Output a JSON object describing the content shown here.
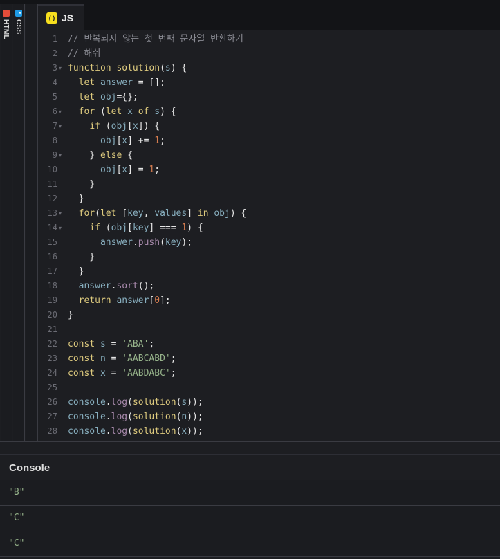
{
  "sidebar": {
    "html_tab": {
      "label": "HTML",
      "icon": "html-icon"
    },
    "css_tab": {
      "label": "CSS",
      "icon": "css-icon"
    }
  },
  "editor_tab": {
    "label": "JS",
    "icon": "js-icon"
  },
  "code_lines": [
    {
      "n": "1",
      "fold": false,
      "tokens": [
        [
          "cm",
          "// 반복되지 않는 첫 번째 문자열 반환하기"
        ]
      ]
    },
    {
      "n": "2",
      "fold": false,
      "tokens": [
        [
          "cm",
          "// 해쉬"
        ]
      ]
    },
    {
      "n": "3",
      "fold": true,
      "tokens": [
        [
          "kw",
          "function "
        ],
        [
          "fn",
          "solution"
        ],
        [
          "pn",
          "("
        ],
        [
          "id",
          "s"
        ],
        [
          "pn",
          ") {"
        ]
      ]
    },
    {
      "n": "4",
      "fold": false,
      "tokens": [
        [
          "pn",
          "  "
        ],
        [
          "kw",
          "let "
        ],
        [
          "id",
          "answer"
        ],
        [
          "pn",
          " = [];"
        ]
      ]
    },
    {
      "n": "5",
      "fold": false,
      "tokens": [
        [
          "pn",
          "  "
        ],
        [
          "kw",
          "let "
        ],
        [
          "id",
          "obj"
        ],
        [
          "pn",
          "={};"
        ]
      ]
    },
    {
      "n": "6",
      "fold": true,
      "tokens": [
        [
          "pn",
          "  "
        ],
        [
          "kw",
          "for "
        ],
        [
          "pn",
          "("
        ],
        [
          "kw",
          "let "
        ],
        [
          "id",
          "x"
        ],
        [
          "kw",
          " of "
        ],
        [
          "id",
          "s"
        ],
        [
          "pn",
          ") {"
        ]
      ]
    },
    {
      "n": "7",
      "fold": true,
      "tokens": [
        [
          "pn",
          "    "
        ],
        [
          "kw",
          "if "
        ],
        [
          "pn",
          "("
        ],
        [
          "id",
          "obj"
        ],
        [
          "pn",
          "["
        ],
        [
          "id",
          "x"
        ],
        [
          "pn",
          "]) {"
        ]
      ]
    },
    {
      "n": "8",
      "fold": false,
      "tokens": [
        [
          "pn",
          "      "
        ],
        [
          "id",
          "obj"
        ],
        [
          "pn",
          "["
        ],
        [
          "id",
          "x"
        ],
        [
          "pn",
          "] += "
        ],
        [
          "num",
          "1"
        ],
        [
          "pn",
          ";"
        ]
      ]
    },
    {
      "n": "9",
      "fold": true,
      "tokens": [
        [
          "pn",
          "    } "
        ],
        [
          "kw",
          "else "
        ],
        [
          "pn",
          "{"
        ]
      ]
    },
    {
      "n": "10",
      "fold": false,
      "tokens": [
        [
          "pn",
          "      "
        ],
        [
          "id",
          "obj"
        ],
        [
          "pn",
          "["
        ],
        [
          "id",
          "x"
        ],
        [
          "pn",
          "] = "
        ],
        [
          "num",
          "1"
        ],
        [
          "pn",
          ";"
        ]
      ]
    },
    {
      "n": "11",
      "fold": false,
      "tokens": [
        [
          "pn",
          "    }"
        ]
      ]
    },
    {
      "n": "12",
      "fold": false,
      "tokens": [
        [
          "pn",
          "  }"
        ]
      ]
    },
    {
      "n": "13",
      "fold": true,
      "tokens": [
        [
          "pn",
          "  "
        ],
        [
          "kw",
          "for"
        ],
        [
          "pn",
          "("
        ],
        [
          "kw",
          "let "
        ],
        [
          "pn",
          "["
        ],
        [
          "id",
          "key"
        ],
        [
          "pn",
          ", "
        ],
        [
          "id",
          "values"
        ],
        [
          "pn",
          "] "
        ],
        [
          "kw",
          "in "
        ],
        [
          "id",
          "obj"
        ],
        [
          "pn",
          ") {"
        ]
      ]
    },
    {
      "n": "14",
      "fold": true,
      "tokens": [
        [
          "pn",
          "    "
        ],
        [
          "kw",
          "if "
        ],
        [
          "pn",
          "("
        ],
        [
          "id",
          "obj"
        ],
        [
          "pn",
          "["
        ],
        [
          "id",
          "key"
        ],
        [
          "pn",
          "] === "
        ],
        [
          "num",
          "1"
        ],
        [
          "pn",
          ") {"
        ]
      ]
    },
    {
      "n": "15",
      "fold": false,
      "tokens": [
        [
          "pn",
          "      "
        ],
        [
          "id",
          "answer"
        ],
        [
          "pn",
          "."
        ],
        [
          "pr",
          "push"
        ],
        [
          "pn",
          "("
        ],
        [
          "id",
          "key"
        ],
        [
          "pn",
          ");"
        ]
      ]
    },
    {
      "n": "16",
      "fold": false,
      "tokens": [
        [
          "pn",
          "    }"
        ]
      ]
    },
    {
      "n": "17",
      "fold": false,
      "tokens": [
        [
          "pn",
          "  }"
        ]
      ]
    },
    {
      "n": "18",
      "fold": false,
      "tokens": [
        [
          "pn",
          "  "
        ],
        [
          "id",
          "answer"
        ],
        [
          "pn",
          "."
        ],
        [
          "pr",
          "sort"
        ],
        [
          "pn",
          "();"
        ]
      ]
    },
    {
      "n": "19",
      "fold": false,
      "tokens": [
        [
          "pn",
          "  "
        ],
        [
          "kw",
          "return "
        ],
        [
          "id",
          "answer"
        ],
        [
          "pn",
          "["
        ],
        [
          "num",
          "0"
        ],
        [
          "pn",
          "];"
        ]
      ]
    },
    {
      "n": "20",
      "fold": false,
      "tokens": [
        [
          "pn",
          "}"
        ]
      ]
    },
    {
      "n": "21",
      "fold": false,
      "tokens": []
    },
    {
      "n": "22",
      "fold": false,
      "tokens": [
        [
          "kw",
          "const "
        ],
        [
          "id",
          "s"
        ],
        [
          "pn",
          " = "
        ],
        [
          "str",
          "'ABA'"
        ],
        [
          "pn",
          ";"
        ]
      ]
    },
    {
      "n": "23",
      "fold": false,
      "tokens": [
        [
          "kw",
          "const "
        ],
        [
          "id",
          "n"
        ],
        [
          "pn",
          " = "
        ],
        [
          "str",
          "'AABCABD'"
        ],
        [
          "pn",
          ";"
        ]
      ]
    },
    {
      "n": "24",
      "fold": false,
      "tokens": [
        [
          "kw",
          "const "
        ],
        [
          "id",
          "x"
        ],
        [
          "pn",
          " = "
        ],
        [
          "str",
          "'AABDABC'"
        ],
        [
          "pn",
          ";"
        ]
      ]
    },
    {
      "n": "25",
      "fold": false,
      "tokens": []
    },
    {
      "n": "26",
      "fold": false,
      "tokens": [
        [
          "id",
          "console"
        ],
        [
          "pn",
          "."
        ],
        [
          "pr",
          "log"
        ],
        [
          "pn",
          "("
        ],
        [
          "fn",
          "solution"
        ],
        [
          "pn",
          "("
        ],
        [
          "id",
          "s"
        ],
        [
          "pn",
          "));"
        ]
      ]
    },
    {
      "n": "27",
      "fold": false,
      "tokens": [
        [
          "id",
          "console"
        ],
        [
          "pn",
          "."
        ],
        [
          "pr",
          "log"
        ],
        [
          "pn",
          "("
        ],
        [
          "fn",
          "solution"
        ],
        [
          "pn",
          "("
        ],
        [
          "id",
          "n"
        ],
        [
          "pn",
          "));"
        ]
      ]
    },
    {
      "n": "28",
      "fold": false,
      "tokens": [
        [
          "id",
          "console"
        ],
        [
          "pn",
          "."
        ],
        [
          "pr",
          "log"
        ],
        [
          "pn",
          "("
        ],
        [
          "fn",
          "solution"
        ],
        [
          "pn",
          "("
        ],
        [
          "id",
          "x"
        ],
        [
          "pn",
          "));"
        ]
      ]
    }
  ],
  "console": {
    "title": "Console",
    "outputs": [
      "\"B\"",
      "\"C\"",
      "\"C\""
    ]
  },
  "colors": {
    "background": "#1d1e22",
    "keyword": "#ddca7e",
    "identifier": "#88afbf",
    "property": "#a88aac",
    "number": "#d47c4f",
    "string": "#96b38a",
    "comment": "#8a8b93"
  }
}
